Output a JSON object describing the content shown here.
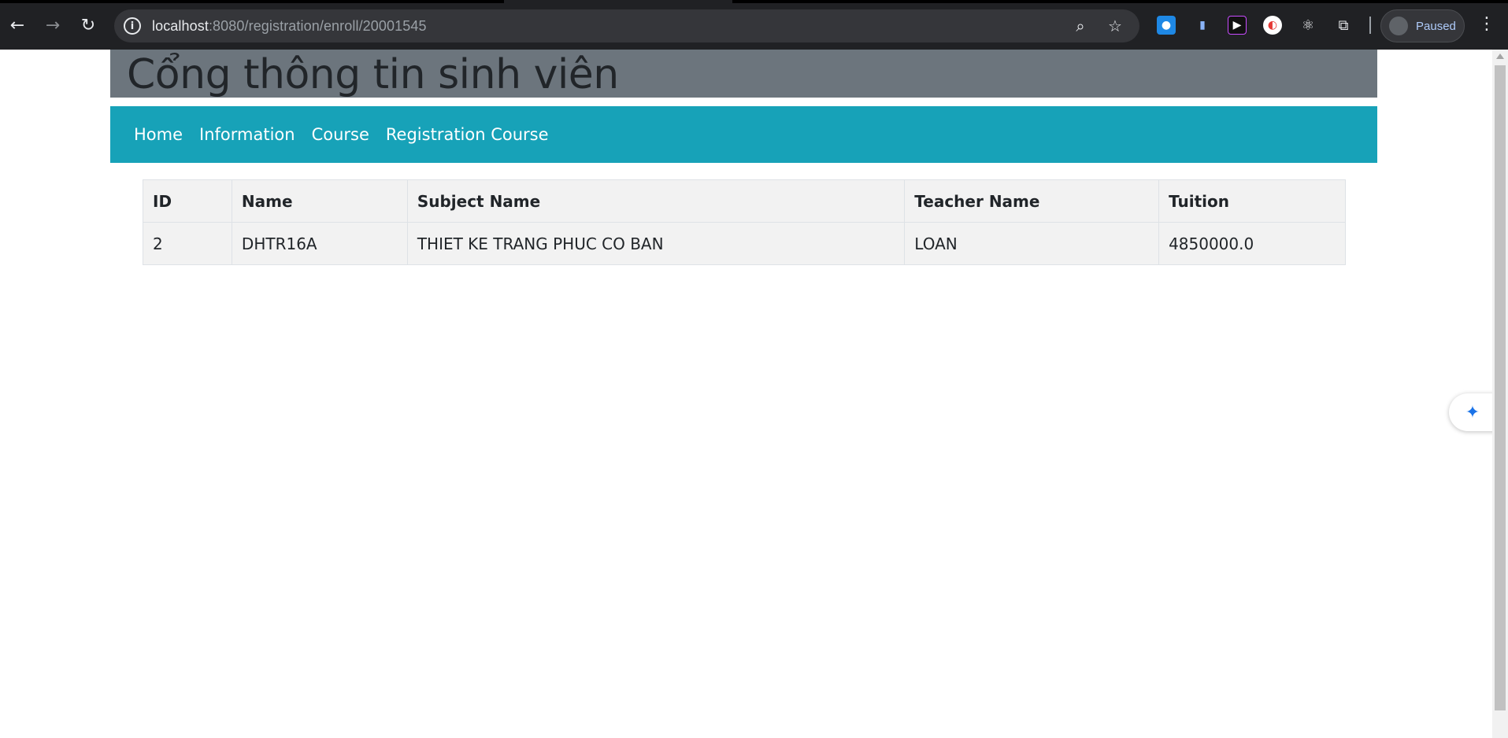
{
  "browser": {
    "url_host": "localhost",
    "url_rest": ":8080/registration/enroll/20001545",
    "back_icon": "←",
    "forward_icon": "→",
    "reload_icon": "↻",
    "info_icon": "i",
    "zoom_icon": "⌕",
    "star_icon": "☆",
    "profile_label": "Paused",
    "menu_icon": "⋮"
  },
  "page": {
    "title": "Cổng thông tin sinh viên",
    "nav": [
      "Home",
      "Information",
      "Course",
      "Registration Course"
    ]
  },
  "table": {
    "headers": [
      "ID",
      "Name",
      "Subject Name",
      "Teacher Name",
      "Tuition"
    ],
    "rows": [
      [
        "2",
        "DHTR16A",
        "THIET KE TRANG PHUC CO BAN",
        "LOAN",
        "4850000.0"
      ]
    ]
  },
  "colors": {
    "header_bg": "#6c757d",
    "navbar_bg": "#17a2b8",
    "table_bg": "#f2f2f2"
  }
}
